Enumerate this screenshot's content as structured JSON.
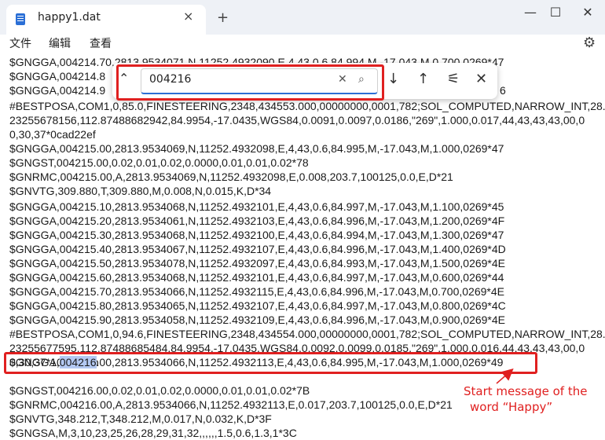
{
  "window": {
    "tab_title": "happy1.dat",
    "tab_close": "×",
    "new_tab": "+",
    "minimize": "—",
    "maximize": "☐",
    "close": "✕"
  },
  "menu": {
    "file": "文件",
    "edit": "编辑",
    "view": "查看"
  },
  "find": {
    "query": "004216"
  },
  "lines": [
    "$GNGGA,004214.70,2813.9534071,N,11252.4932090,E,4,43,0.6,84.994,M,-17.043,M,0.700,0269*47",
    "$GNGGA,004214.8",
    "$GNGGA,004214.9",
    "#BESTPOSA,COM1,0,85.0,FINESTEERING,2348,434553.000,00000000,0001,782;SOL_COMPUTED,NARROW_INT,28.",
    "23255678156,112.87488682942,84.9954,-17.0435,WGS84,0.0091,0.0097,0.0186,\"269\",1.000,0.017,44,43,43,43,00,0",
    "0,30,37*0cad22ef",
    "$GNGGA,004215.00,2813.9534069,N,11252.4932098,E,4,43,0.6,84.995,M,-17.043,M,1.000,0269*47",
    "$GNGST,004215.00,0.02,0.01,0.02,0.0000,0.01,0.01,0.02*78",
    "$GNRMC,004215.00,A,2813.9534069,N,11252.4932098,E,0.008,203.7,100125,0.0,E,D*21",
    "$GNVTG,309.880,T,309.880,M,0.008,N,0.015,K,D*34",
    "$GNGGA,004215.10,2813.9534068,N,11252.4932101,E,4,43,0.6,84.997,M,-17.043,M,1.100,0269*45",
    "$GNGGA,004215.20,2813.9534061,N,11252.4932103,E,4,43,0.6,84.996,M,-17.043,M,1.200,0269*4F",
    "$GNGGA,004215.30,2813.9534068,N,11252.4932100,E,4,43,0.6,84.994,M,-17.043,M,1.300,0269*47",
    "$GNGGA,004215.40,2813.9534067,N,11252.4932107,E,4,43,0.6,84.996,M,-17.043,M,1.400,0269*4D",
    "$GNGGA,004215.50,2813.9534078,N,11252.4932097,E,4,43,0.6,84.993,M,-17.043,M,1.500,0269*4E",
    "$GNGGA,004215.60,2813.9534068,N,11252.4932101,E,4,43,0.6,84.997,M,-17.043,M,0.600,0269*44",
    "$GNGGA,004215.70,2813.9534066,N,11252.4932115,E,4,43,0.6,84.996,M,-17.043,M,0.700,0269*4E",
    "$GNGGA,004215.80,2813.9534065,N,11252.4932107,E,4,43,0.6,84.997,M,-17.043,M,0.800,0269*4C",
    "$GNGGA,004215.90,2813.9534058,N,11252.4932109,E,4,43,0.6,84.996,M,-17.043,M,0.900,0269*4E",
    "#BESTPOSA,COM1,0,94.6,FINESTEERING,2348,434554.000,00000000,0001,782;SOL_COMPUTED,NARROW_INT,28.",
    "23255677595,112.87488685484,84.9954,-17.0435,WGS84,0.0092,0.0099,0.0185,\"269\",1.000,0.016,44,43,43,43,00,0",
    "0,30,37*10c8b6bb",
    "$GNGST,004216.00,0.02,0.01,0.02,0.0000,0.01,0.01,0.02*7B",
    "$GNRMC,004216.00,A,2813.9534066,N,11252.4932113,E,0.017,203.7,100125,0.0,E,D*21",
    "$GNVTG,348.212,T,348.212,M,0.017,N,0.032,K,D*3F",
    "$GNGSA,M,3,10,23,25,26,28,29,31,32,,,,,,1.5,0.6,1.3,1*3C"
  ],
  "line_1b_tail": "6",
  "highlighted_line": {
    "prefix": "$GNGGA,",
    "match": "004216",
    "suffix": ".00,2813.9534066,N,11252.4932113,E,4,43,0.6,84.995,M,-17.043,M,1.000,0269*49"
  },
  "annotation": {
    "line1": "Start message of the",
    "line2": "word “Happy”"
  },
  "colors": {
    "annotation_red": "#e02020",
    "match_highlight": "#b3c8f2",
    "accent_blue": "#2b6fd6"
  }
}
